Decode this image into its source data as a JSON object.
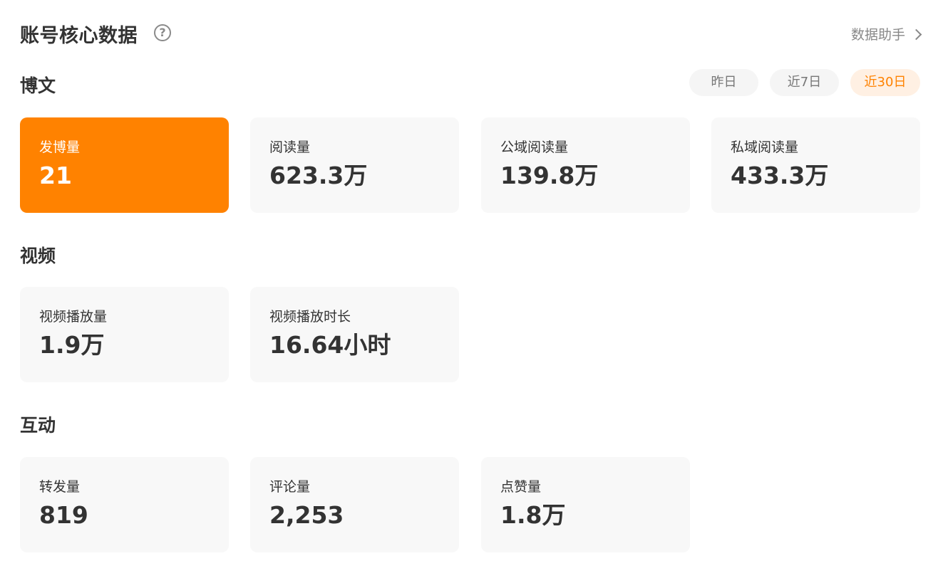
{
  "header": {
    "title": "账号核心数据",
    "help_icon": "question-circle-icon",
    "assistant_label": "数据助手",
    "assistant_icon": "chevron-right-icon"
  },
  "range_tabs": [
    {
      "label": "昨日",
      "active": false
    },
    {
      "label": "近7日",
      "active": false
    },
    {
      "label": "近30日",
      "active": true
    }
  ],
  "sections": {
    "posts": {
      "title": "博文",
      "cards": [
        {
          "label": "发博量",
          "value": "21",
          "highlighted": true
        },
        {
          "label": "阅读量",
          "value": "623.3万",
          "highlighted": false
        },
        {
          "label": "公域阅读量",
          "value": "139.8万",
          "highlighted": false
        },
        {
          "label": "私域阅读量",
          "value": "433.3万",
          "highlighted": false
        }
      ]
    },
    "video": {
      "title": "视频",
      "cards": [
        {
          "label": "视频播放量",
          "value": "1.9万"
        },
        {
          "label": "视频播放时长",
          "value": "16.64小时"
        }
      ]
    },
    "interaction": {
      "title": "互动",
      "cards": [
        {
          "label": "转发量",
          "value": "819"
        },
        {
          "label": "评论量",
          "value": "2,253"
        },
        {
          "label": "点赞量",
          "value": "1.8万"
        }
      ]
    }
  },
  "colors": {
    "accent": "#ff8200",
    "accent_soft": "#fff0e3",
    "card_bg": "#f8f8f8",
    "text": "#333333",
    "muted": "#888888"
  }
}
